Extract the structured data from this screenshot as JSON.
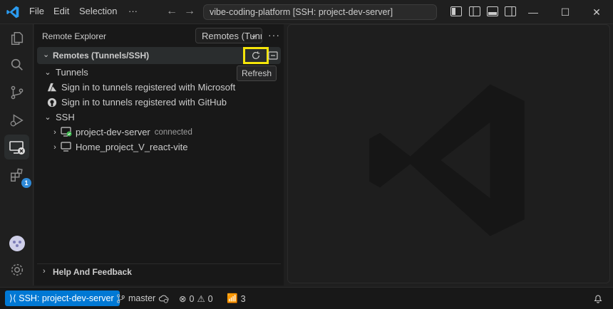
{
  "menu": {
    "file": "File",
    "edit": "Edit",
    "selection": "Selection",
    "more": "···"
  },
  "search": {
    "value": "vibe-coding-platform [SSH: project-dev-server]"
  },
  "window_controls": {
    "minimize": "—",
    "maximize": "☐",
    "close": "✕"
  },
  "activity": {
    "extensions_badge": "1"
  },
  "sidebar": {
    "title": "Remote Explorer",
    "dropdown_value": "Remotes (Tunnels/SSH)",
    "more": "···",
    "section_title": "Remotes (Tunnels/SSH)",
    "tooltip": "Refresh",
    "tunnels_label": "Tunnels",
    "tunnel_microsoft": "Sign in to tunnels registered with Microsoft",
    "tunnel_github": "Sign in to tunnels registered with GitHub",
    "ssh_label": "SSH",
    "hosts": [
      {
        "name": "project-dev-server",
        "status": "connected"
      },
      {
        "name": "Home_project_V_react-vite",
        "status": ""
      }
    ],
    "help_label": "Help And Feedback"
  },
  "status": {
    "remote": "SSH: project-dev-server",
    "branch": "master",
    "errors": "0",
    "warnings": "0",
    "ports": "3"
  },
  "colors": {
    "accent": "#0078d4",
    "highlight": "#f5e50a",
    "connected": "#3fb950"
  }
}
